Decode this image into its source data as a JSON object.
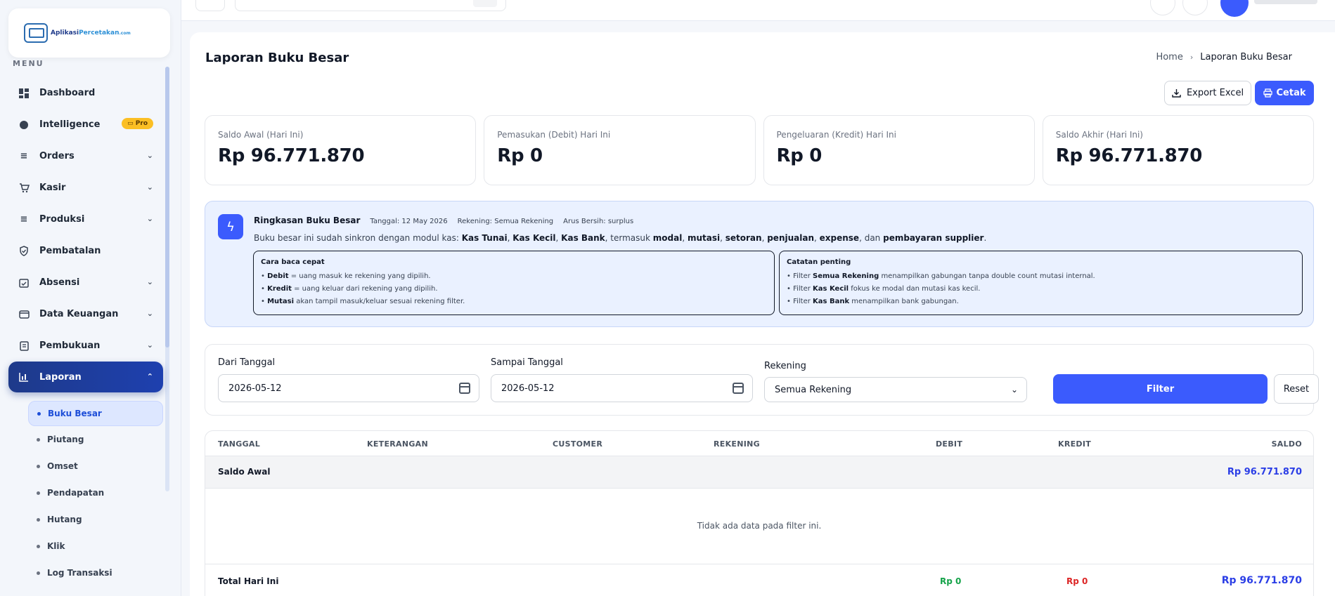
{
  "brand": {
    "name_part1": "Aplikasi",
    "name_part2": "Percetakan",
    "name_suffix": ".com"
  },
  "sidebar": {
    "menu_label": "MENU",
    "items": [
      {
        "label": "Dashboard",
        "icon": "dashboard-icon"
      },
      {
        "label": "Intelligence",
        "icon": "intelligence-icon",
        "badge": "Pro"
      },
      {
        "label": "Orders",
        "icon": "orders-icon"
      },
      {
        "label": "Kasir",
        "icon": "cart-icon"
      },
      {
        "label": "Produksi",
        "icon": "produksi-icon"
      },
      {
        "label": "Pembatalan",
        "icon": "shield-icon"
      },
      {
        "label": "Absensi",
        "icon": "calendar-check-icon"
      },
      {
        "label": "Data Keuangan",
        "icon": "wallet-icon"
      },
      {
        "label": "Pembukuan",
        "icon": "book-icon"
      },
      {
        "label": "Laporan",
        "icon": "bar-chart-icon"
      }
    ],
    "sub_items": [
      "Buku Besar",
      "Piutang",
      "Omset",
      "Pendapatan",
      "Hutang",
      "Klik",
      "Log Transaksi"
    ]
  },
  "page": {
    "title": "Laporan Buku Besar",
    "breadcrumb": {
      "home": "Home",
      "current": "Laporan Buku Besar"
    },
    "export_label": "Export Excel",
    "print_label": "Cetak"
  },
  "stats": [
    {
      "label": "Saldo Awal (Hari Ini)",
      "value": "Rp 96.771.870"
    },
    {
      "label": "Pemasukan (Debit) Hari Ini",
      "value": "Rp 0"
    },
    {
      "label": "Pengeluaran (Kredit) Hari Ini",
      "value": "Rp 0"
    },
    {
      "label": "Saldo Akhir (Hari Ini)",
      "value": "Rp 96.771.870"
    }
  ],
  "summary": {
    "title": "Ringkasan Buku Besar",
    "tanggal": "Tanggal: 12 May 2026",
    "rekening": "Rekening: Semua Rekening",
    "arus": "Arus Bersih: surplus",
    "desc": {
      "t1": "Buku besar ini sudah sinkron dengan modul kas: ",
      "b1": "Kas Tunai",
      "t2": ", ",
      "b2": "Kas Kecil",
      "t3": ", ",
      "b3": "Kas Bank",
      "t4": ", termasuk ",
      "b4": "modal",
      "t5": ", ",
      "b5": "mutasi",
      "t6": ", ",
      "b6": "setoran",
      "t7": ", ",
      "b7": "penjualan",
      "t8": ", ",
      "b8": "expense",
      "t9": ", dan ",
      "b9": "pembayaran supplier",
      "t10": "."
    },
    "quick": {
      "title": "Cara baca cepat",
      "l1a": "• ",
      "l1b": "Debit",
      "l1c": " = uang masuk ke rekening yang dipilih.",
      "l2a": "• ",
      "l2b": "Kredit",
      "l2c": " = uang keluar dari rekening yang dipilih.",
      "l3a": "• ",
      "l3b": "Mutasi",
      "l3c": " akan tampil masuk/keluar sesuai rekening filter."
    },
    "notes": {
      "title": "Catatan penting",
      "l1a": "• Filter ",
      "l1b": "Semua Rekening",
      "l1c": " menampilkan gabungan tanpa double count mutasi internal.",
      "l2a": "• Filter ",
      "l2b": "Kas Kecil",
      "l2c": " fokus ke modal dan mutasi kas kecil.",
      "l3a": "• Filter ",
      "l3b": "Kas Bank",
      "l3c": " menampilkan bank gabungan."
    }
  },
  "filter": {
    "from_label": "Dari Tanggal",
    "from_value": "2026-05-12",
    "to_label": "Sampai Tanggal",
    "to_value": "2026-05-12",
    "rekening_label": "Rekening",
    "rekening_value": "Semua Rekening",
    "filter_button": "Filter",
    "reset_button": "Reset"
  },
  "table": {
    "headers": [
      "TANGGAL",
      "KETERANGAN",
      "CUSTOMER",
      "REKENING",
      "DEBIT",
      "KREDIT",
      "SALDO"
    ],
    "saldo_awal_label": "Saldo Awal",
    "saldo_awal_value": "Rp 96.771.870",
    "empty_message": "Tidak ada data pada filter ini.",
    "total_label": "Total Hari Ini",
    "total_debit": "Rp 0",
    "total_kredit": "Rp 0",
    "total_saldo": "Rp 96.771.870"
  },
  "colors": {
    "primary": "#3b5bfd",
    "active_nav": "#1e3a8a",
    "debit": "#16a34a",
    "kredit": "#dc2626",
    "saldo": "#2b3ee6"
  }
}
